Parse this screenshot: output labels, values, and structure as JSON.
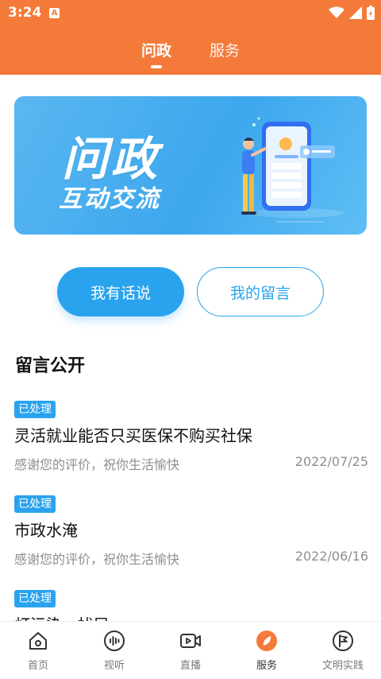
{
  "status": {
    "time": "3:24",
    "notif_letter": "A"
  },
  "header": {
    "tabs": [
      {
        "label": "问政",
        "active": true
      },
      {
        "label": "服务",
        "active": false
      }
    ]
  },
  "banner": {
    "title": "问政",
    "subtitle": "互动交流"
  },
  "actions": {
    "speak_label": "我有话说",
    "mymsg_label": "我的留言"
  },
  "section": {
    "title": "留言公开"
  },
  "messages": [
    {
      "badge": "已处理",
      "title": "灵活就业能否只买医保不购买社保",
      "reply": "感谢您的评价，祝你生活愉快",
      "date": "2022/07/25"
    },
    {
      "badge": "已处理",
      "title": "市政水淹",
      "reply": "感谢您的评价，祝你生活愉快",
      "date": "2022/06/16"
    },
    {
      "badge": "已处理",
      "title": "灯污染　扰民",
      "reply": "",
      "date": ""
    }
  ],
  "tabbar": {
    "items": [
      {
        "label": "首页",
        "icon": "home-icon",
        "active": false
      },
      {
        "label": "视听",
        "icon": "audio-wave-icon",
        "active": false
      },
      {
        "label": "直播",
        "icon": "live-video-icon",
        "active": false
      },
      {
        "label": "服务",
        "icon": "compass-leaf-icon",
        "active": true
      },
      {
        "label": "文明实践",
        "icon": "flag-circle-icon",
        "active": false
      }
    ]
  },
  "colors": {
    "brand_orange": "#f47a3a",
    "accent_blue": "#2aa3ee"
  }
}
